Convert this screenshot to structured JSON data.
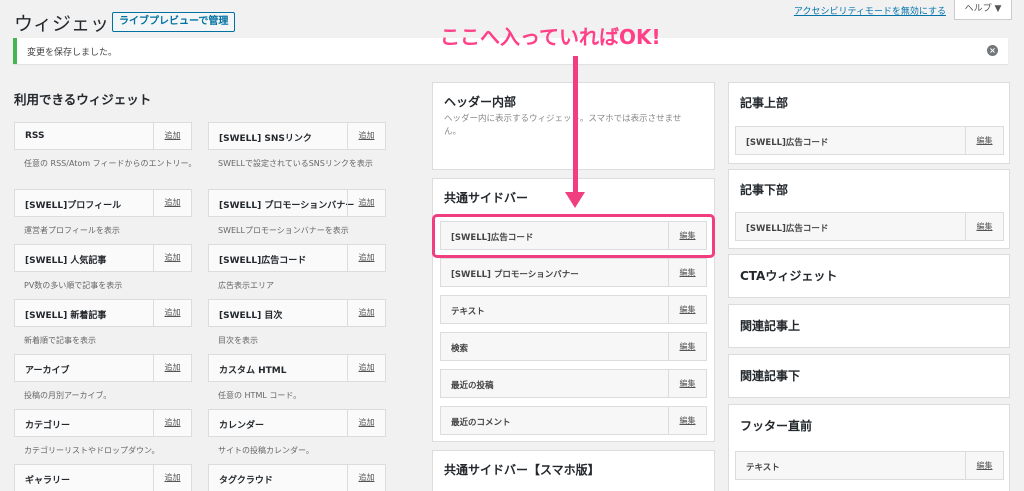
{
  "header": {
    "title": "ウィジェット",
    "live_preview": "ライブプレビューで管理",
    "a11y_link": "アクセシビリティモードを無効にする",
    "help": "ヘルプ ▼"
  },
  "notice": {
    "text": "変更を保存しました。",
    "close": "×"
  },
  "available": {
    "title": "利用できるウィジェット",
    "add_label": "追加",
    "items": [
      {
        "name": "RSS",
        "desc": "任意の RSS/Atom フィードからのエントリー。"
      },
      {
        "name": "[SWELL] SNSリンク",
        "desc": "SWELLで設定されているSNSリンクを表示"
      },
      {
        "name": "[SWELL]プロフィール",
        "desc": "運営者プロフィールを表示"
      },
      {
        "name": "[SWELL] プロモーションバナー",
        "desc": "SWELLプロモーションバナーを表示"
      },
      {
        "name": "[SWELL] 人気記事",
        "desc": "PV数の多い順で記事を表示"
      },
      {
        "name": "[SWELL]広告コード",
        "desc": "広告表示エリア"
      },
      {
        "name": "[SWELL] 新着記事",
        "desc": "新着順で記事を表示"
      },
      {
        "name": "[SWELL] 目次",
        "desc": "目次を表示"
      },
      {
        "name": "アーカイブ",
        "desc": "投稿の月別アーカイブ。"
      },
      {
        "name": "カスタム HTML",
        "desc": "任意の HTML コード。"
      },
      {
        "name": "カテゴリー",
        "desc": "カテゴリーリストやドロップダウン。"
      },
      {
        "name": "カレンダー",
        "desc": "サイトの投稿カレンダー。"
      },
      {
        "name": "ギャラリー",
        "desc": ""
      },
      {
        "name": "タグクラウド",
        "desc": ""
      }
    ]
  },
  "edit_label": "編集",
  "middle": {
    "header_area": {
      "title": "ヘッダー内部",
      "desc": "ヘッダー内に表示するウィジェット。スマホでは表示させません。"
    },
    "common_sidebar": {
      "title": "共通サイドバー",
      "widgets": [
        "[SWELL]広告コード",
        "[SWELL] プロモーションバナー",
        "テキスト",
        "検索",
        "最近の投稿",
        "最近のコメント"
      ]
    },
    "mobile_sidebar": {
      "title": "共通サイドバー【スマホ版】"
    }
  },
  "right": {
    "article_top": {
      "title": "記事上部",
      "widget": "[SWELL]広告コード"
    },
    "article_bottom": {
      "title": "記事下部",
      "widget": "[SWELL]広告コード"
    },
    "cta": {
      "title": "CTAウィジェット"
    },
    "related_top": {
      "title": "関連記事上"
    },
    "related_bottom": {
      "title": "関連記事下"
    },
    "footer_before": {
      "title": "フッター直前",
      "widget": "テキスト"
    }
  },
  "annotation": {
    "callout": "ここへ入っていればOK!",
    "color": "#f03e80"
  }
}
